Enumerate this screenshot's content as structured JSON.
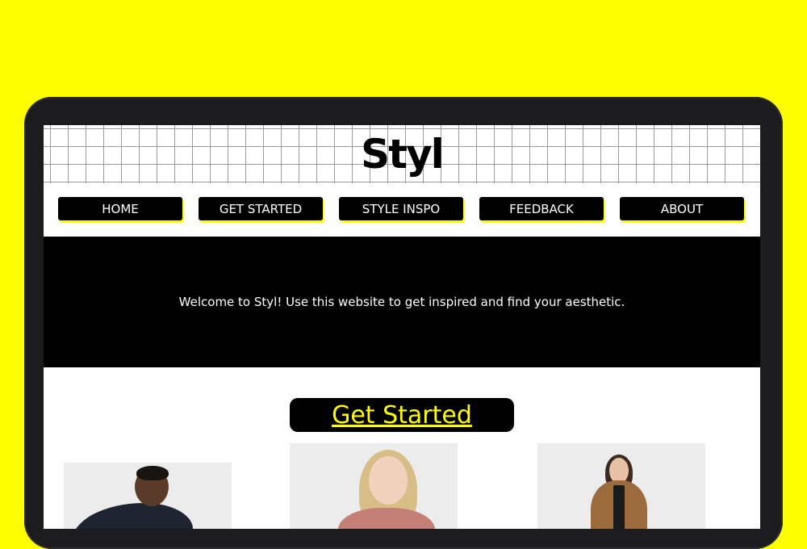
{
  "site": {
    "logo": "Styl"
  },
  "nav": {
    "items": [
      {
        "label": "HOME"
      },
      {
        "label": "GET STARTED"
      },
      {
        "label": "STYLE INSPO"
      },
      {
        "label": "FEEDBACK"
      },
      {
        "label": "ABOUT"
      }
    ]
  },
  "hero": {
    "welcome_text": "Welcome to Styl! Use this website to get inspired and find your aesthetic."
  },
  "content": {
    "cta_label": "Get Started"
  },
  "colors": {
    "background": "#FFFF00",
    "accent": "#FFFF00",
    "dark": "#000000"
  }
}
